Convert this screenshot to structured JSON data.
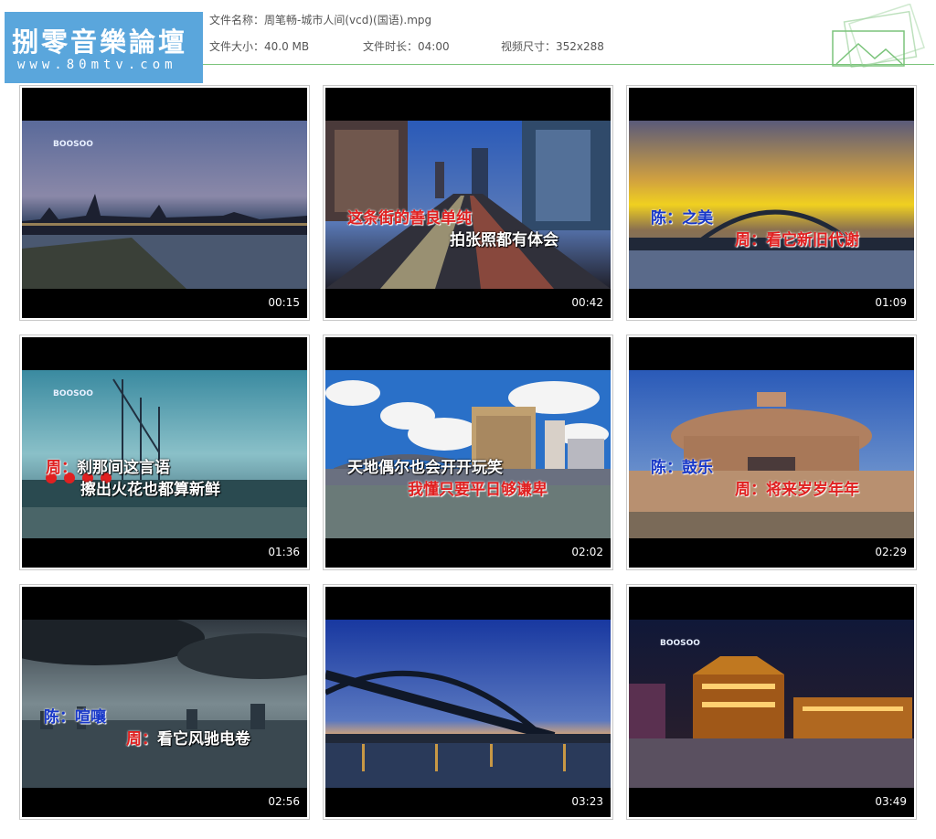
{
  "header": {
    "logo_title": "捌零音樂論壇",
    "logo_url": "www.80mtv.com",
    "filename_label": "文件名称：",
    "filename": "周笔畅-城市人间(vcd)(国语).mpg",
    "filesize_label": "文件大小：",
    "filesize": "40.0 MB",
    "duration_label": "文件时长：",
    "duration": "04:00",
    "resolution_label": "视频尺寸：",
    "resolution": "352x288",
    "accent_color": "#7bc47b",
    "logo_color": "#5aa6dc"
  },
  "thumbnails": [
    {
      "time": "00:15",
      "brand": "BOOSOO",
      "lines": []
    },
    {
      "time": "00:42",
      "lines": [
        {
          "text": "这条街的善良单纯"
        },
        {
          "text": "拍张照都有体会"
        }
      ]
    },
    {
      "time": "01:09",
      "lines": [
        {
          "prefix": "陈：",
          "text": "之美"
        },
        {
          "prefix": "周：",
          "text": "看它新旧代谢"
        }
      ]
    },
    {
      "time": "01:36",
      "brand": "BOOSOO",
      "lines": [
        {
          "prefix": "周：",
          "text": "刹那间这言语"
        },
        {
          "text": "擦出火花也都算新鲜"
        }
      ]
    },
    {
      "time": "02:02",
      "lines": [
        {
          "text": "天地偶尔也会开开玩笑"
        },
        {
          "text": "我懂只要平日够谦卑"
        }
      ]
    },
    {
      "time": "02:29",
      "lines": [
        {
          "prefix": "陈：",
          "text": "鼓乐"
        },
        {
          "prefix": "周：",
          "text": "将来岁岁年年"
        }
      ]
    },
    {
      "time": "02:56",
      "lines": [
        {
          "prefix": "陈：",
          "text": "喧嚷"
        },
        {
          "prefix": "周：",
          "text": "看它风驰电卷"
        }
      ]
    },
    {
      "time": "03:23",
      "lines": []
    },
    {
      "time": "03:49",
      "brand": "BOOSOO",
      "lines": []
    }
  ]
}
